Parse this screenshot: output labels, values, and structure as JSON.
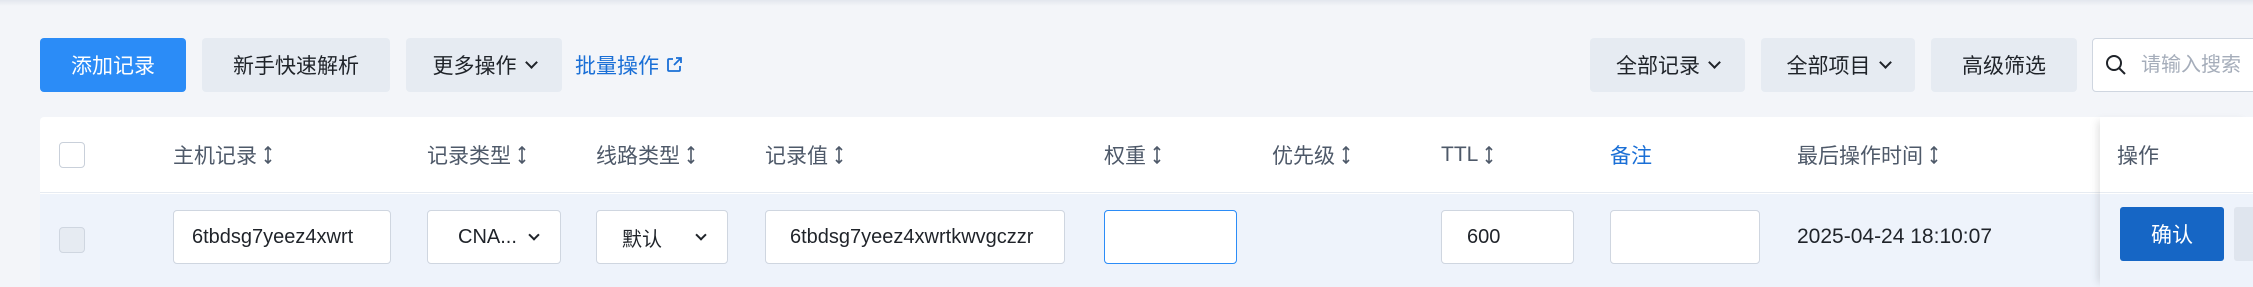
{
  "toolbar": {
    "add_record": "添加记录",
    "quick_parse": "新手快速解析",
    "more_actions": "更多操作",
    "batch_ops": "批量操作",
    "all_records": "全部记录",
    "all_items": "全部项目",
    "advanced_filter": "高级筛选",
    "search_placeholder": "请输入搜索"
  },
  "table": {
    "headers": {
      "host": "主机记录",
      "type": "记录类型",
      "line": "线路类型",
      "value": "记录值",
      "weight": "权重",
      "priority": "优先级",
      "ttl": "TTL",
      "note": "备注",
      "last_modified": "最后操作时间",
      "actions": "操作"
    },
    "edit_row": {
      "host": "6tbdsg7yeez4xwrt",
      "type": "CNA...",
      "line": "默认",
      "value": "6tbdsg7yeez4xwrtkwvgczzr",
      "weight": "",
      "ttl": "600",
      "note": "",
      "last_modified": "2025-04-24 18:10:07",
      "confirm": "确认"
    }
  },
  "colors": {
    "primary": "#2b8cf7",
    "confirm": "#1666c5",
    "link": "#1a6fd6",
    "background": "#f3f5f9"
  }
}
